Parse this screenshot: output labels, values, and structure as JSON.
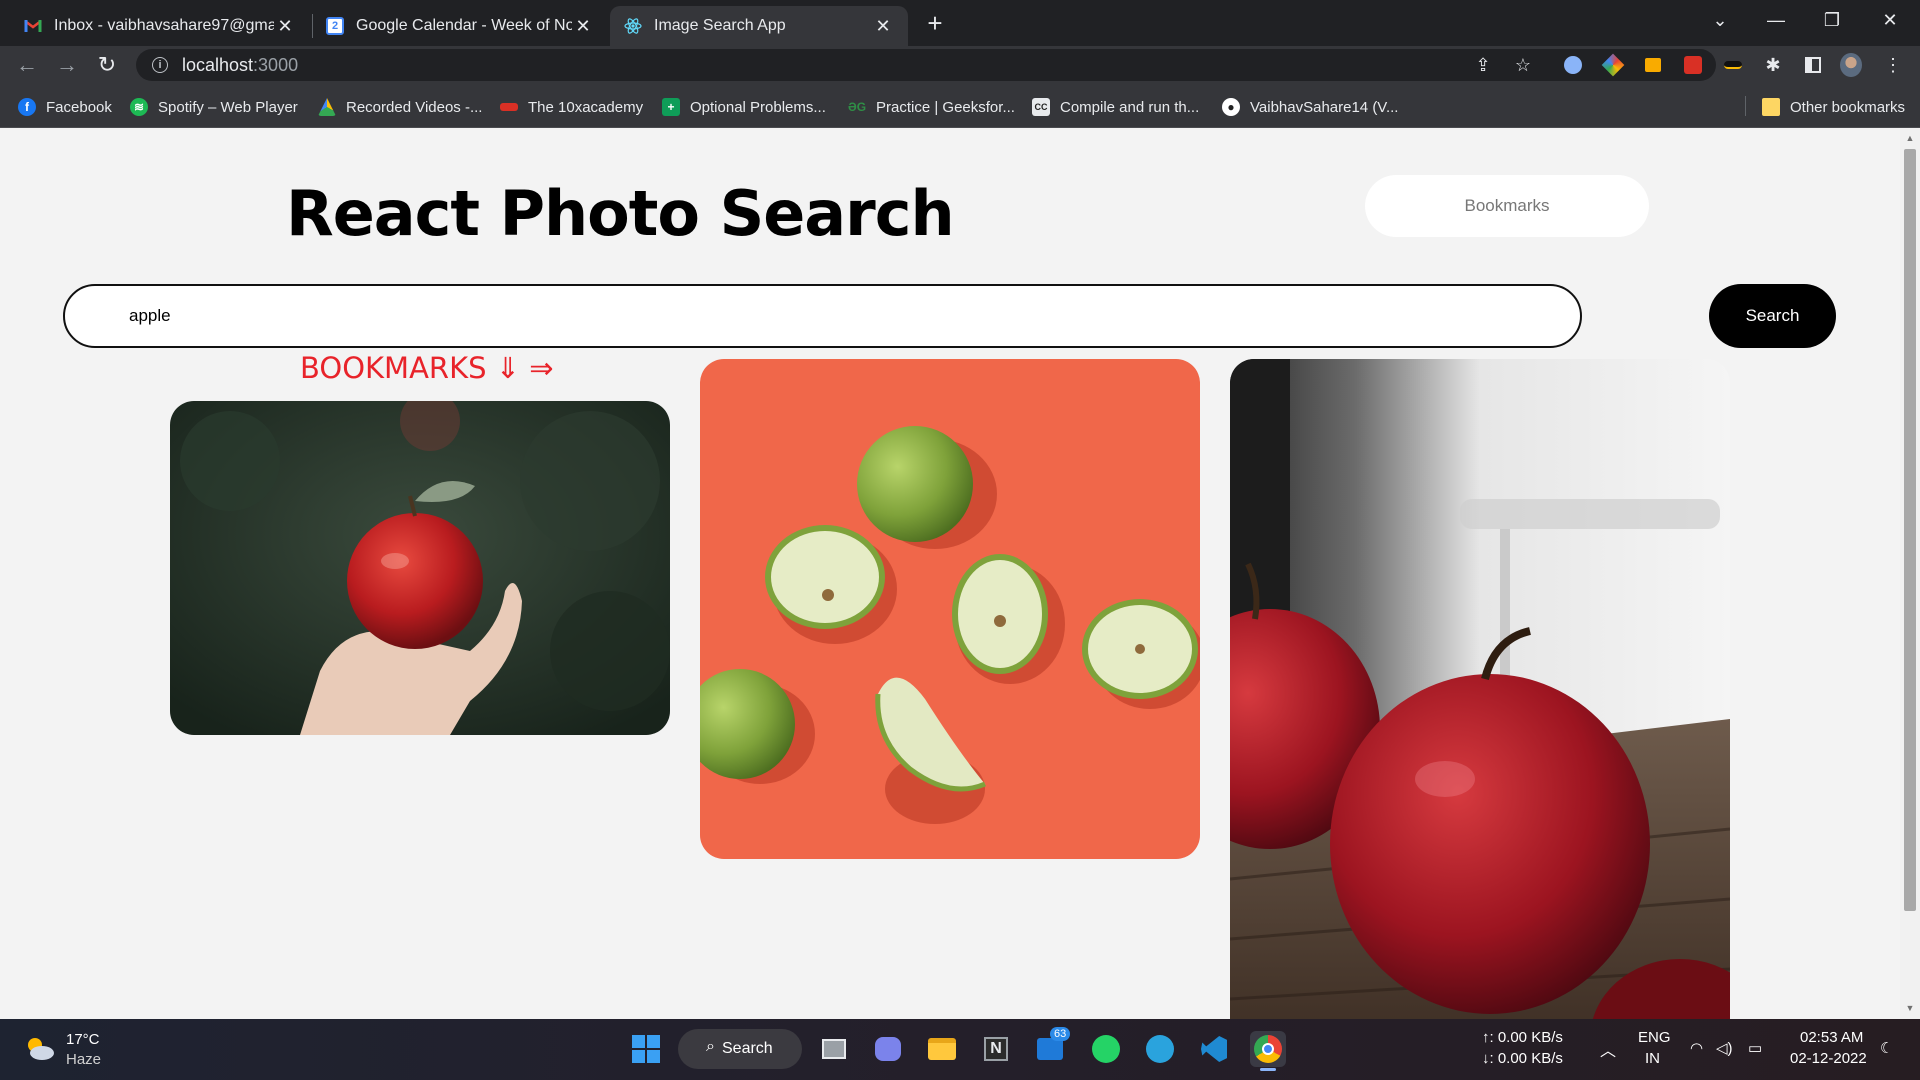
{
  "browser": {
    "tabs": [
      {
        "title": "Inbox - vaibhavsahare97@gmail.",
        "icon": "gmail-icon"
      },
      {
        "title": "Google Calendar - Week of Nove",
        "icon": "calendar-icon"
      },
      {
        "title": "Image Search App",
        "icon": "react-icon"
      }
    ],
    "url_host": "localhost",
    "url_port": ":3000",
    "bookmarks": [
      "Facebook",
      "Spotify – Web Player",
      "Recorded Videos -...",
      "The 10xacademy",
      "Optional Problems...",
      "Practice | Geeksfor...",
      "Compile and run th...",
      "VaibhavSahare14 (V..."
    ],
    "other_bookmarks": "Other bookmarks",
    "calendar_badge": "2"
  },
  "app": {
    "title": "React Photo Search",
    "bookmarks_button": "Bookmarks",
    "search_value": "apple",
    "search_button": "Search",
    "bookmarks_label": "BOOKMARKS ⇓ ⇒"
  },
  "photos": [
    {
      "subject": "hand holding a red apple"
    },
    {
      "subject": "green apples on orange background"
    },
    {
      "subject": "red apples on wooden table"
    }
  ],
  "taskbar": {
    "weather_temp": "17°C",
    "weather_desc": "Haze",
    "search_label": "Search",
    "mail_badge": "63",
    "net_up": "↑: 0.00 KB/s",
    "net_down": "↓: 0.00 KB/s",
    "lang": "ENG",
    "region": "IN",
    "time": "02:53 AM",
    "date": "02-12-2022"
  },
  "colors": {
    "bookmarks_label": "#e8232a",
    "search_button_bg": "#000000",
    "photo2_bg": "#f0674a"
  }
}
